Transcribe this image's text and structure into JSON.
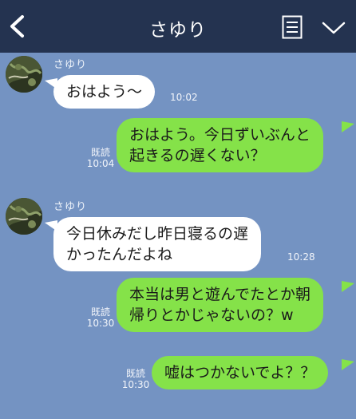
{
  "header": {
    "title": "さゆり",
    "back_icon": "chevron-left-icon",
    "note_icon": "note-icon",
    "menu_icon": "chevron-down-icon"
  },
  "colors": {
    "header": "#243350",
    "background": "#7493c2",
    "incoming_bubble": "#ffffff",
    "outgoing_bubble": "#85e249"
  },
  "messages": [
    {
      "direction": "in",
      "sender": "さゆり",
      "lines": [
        "おはよう〜"
      ],
      "time": "10:02"
    },
    {
      "direction": "out",
      "lines": [
        "おはよう。今日ずいぶんと",
        "起きるの遅くない？"
      ],
      "read": "既読",
      "time": "10:04"
    },
    {
      "direction": "in",
      "sender": "さゆり",
      "lines": [
        "今日休みだし昨日寝るの遅",
        "かったんだよね"
      ],
      "time": "10:28"
    },
    {
      "direction": "out",
      "lines": [
        "本当は男と遊んでたとか朝",
        "帰りとかじゃないの？w"
      ],
      "read": "既読",
      "time": "10:30"
    },
    {
      "direction": "out",
      "lines": [
        "嘘はつかないでよ？？"
      ],
      "read": "既読",
      "time": "10:30"
    }
  ]
}
